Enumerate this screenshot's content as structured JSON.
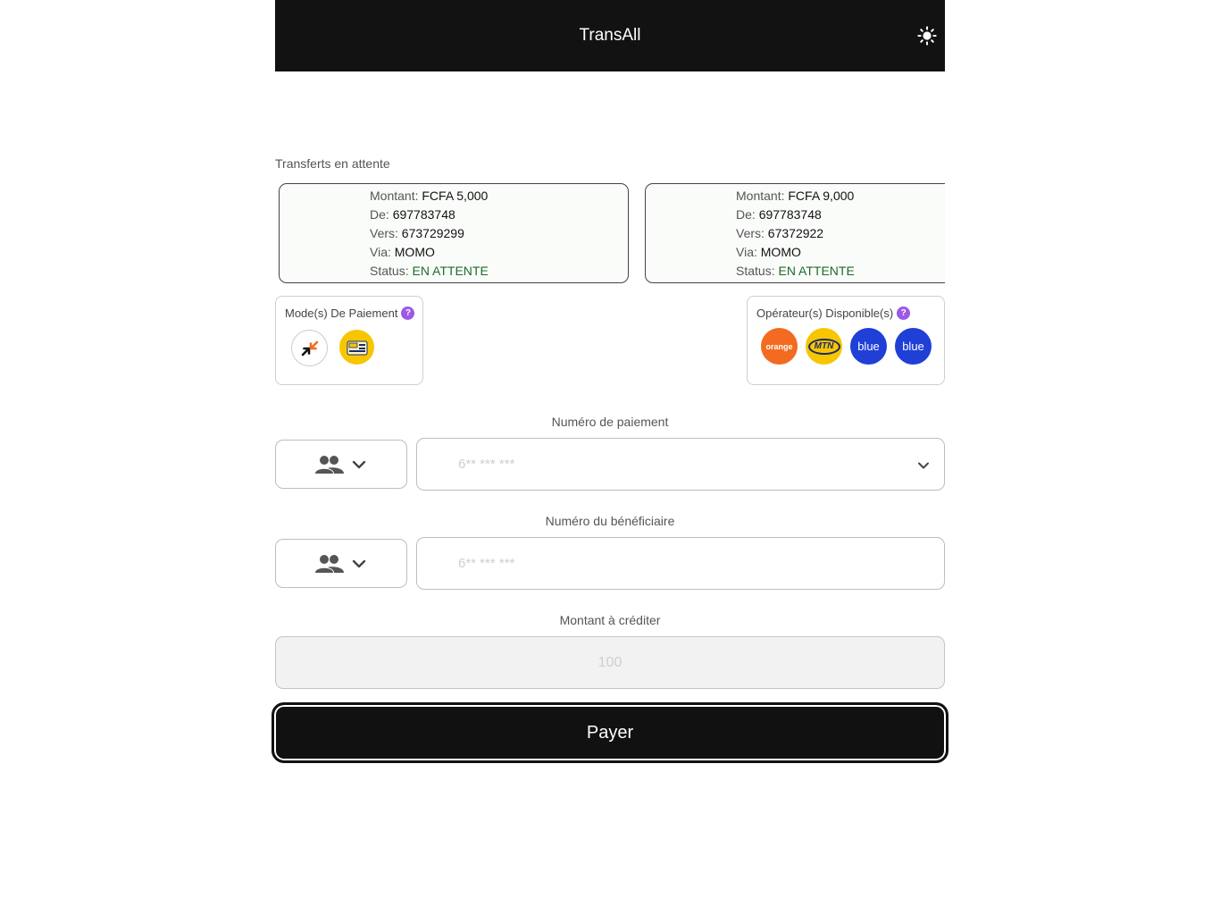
{
  "header": {
    "title": "TransAll",
    "theme_icon": "sun-icon"
  },
  "pending": {
    "label": "Transferts en attente",
    "keys": {
      "amount": "Montant:",
      "from": "De:",
      "to": "Vers:",
      "via": "Via:",
      "status": "Status:"
    },
    "items": [
      {
        "amount": "FCFA 5,000",
        "from": "697783748",
        "to": "673729299",
        "via": "MOMO",
        "status": "EN ATTENTE"
      },
      {
        "amount": "FCFA 9,000",
        "from": "697783748",
        "to": "67372922",
        "via": "MOMO",
        "status": "EN ATTENTE"
      }
    ]
  },
  "payment_modes": {
    "title": "Mode(s) De Paiement",
    "help": "?",
    "items": [
      "orange-money-logo",
      "mtn-mobile-money-logo"
    ]
  },
  "operators": {
    "title": "Opérateur(s) Disponible(s)",
    "help": "?",
    "items": [
      {
        "name": "orange",
        "label": "orange",
        "color": "#f26b21"
      },
      {
        "name": "mtn",
        "label": "MTN",
        "color": "#f7c600"
      },
      {
        "name": "blue",
        "label": "blue",
        "color": "#1f3fd6"
      },
      {
        "name": "blue",
        "label": "blue",
        "color": "#1f3fd6"
      }
    ]
  },
  "form": {
    "payment_number_label": "Numéro de paiement",
    "payment_number_placeholder": "6** *** ***",
    "beneficiary_label": "Numéro du bénéficiaire",
    "beneficiary_placeholder": "6** *** ***",
    "amount_label": "Montant à créditer",
    "amount_placeholder": "100",
    "submit_label": "Payer"
  },
  "colors": {
    "header_bg": "#121212",
    "status_green": "#1f6b2a",
    "help_purple": "#9b59e6"
  }
}
